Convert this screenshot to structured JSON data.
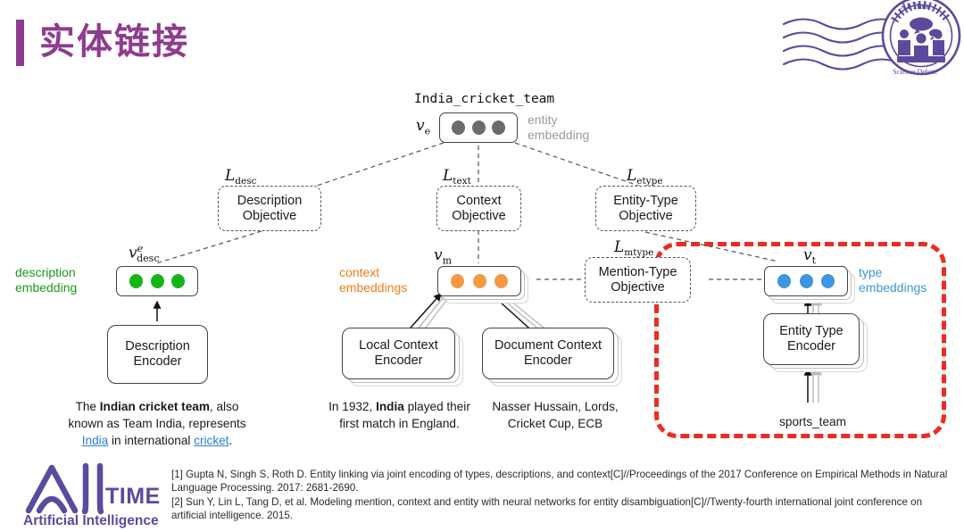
{
  "slide": {
    "title": "实体链接",
    "accent_color": "#8e3c8e"
  },
  "logos": {
    "topright": {
      "name": "ai-time-seal-logo",
      "ring_top_text": "AI Time",
      "ring_bottom_text": "Science Debate"
    },
    "bottom": {
      "name": "ai-time-logo",
      "wordmark": "TIME",
      "subtitle": "Artificial Intelligence"
    }
  },
  "diagram": {
    "entity_name": "India_cricket_team",
    "entity_embedding": {
      "vec_label_base": "v",
      "vec_label_sub": "e",
      "side_label_line1": "entity",
      "side_label_line2": "embedding",
      "dot_color": "#6b6b6b",
      "label_color": "#9a9a9a",
      "dots": 3
    },
    "objectives": [
      {
        "name": "description-objective",
        "loss": "L",
        "loss_sub": "desc",
        "line1": "Description",
        "line2": "Objective"
      },
      {
        "name": "context-objective",
        "loss": "L",
        "loss_sub": "text",
        "line1": "Context",
        "line2": "Objective"
      },
      {
        "name": "entity-type-objective",
        "loss": "L",
        "loss_sub": "etype",
        "line1": "Entity-Type",
        "line2": "Objective"
      },
      {
        "name": "mention-type-objective",
        "loss": "L",
        "loss_sub": "mtype",
        "line1": "Mention-Type",
        "line2": "Objective"
      }
    ],
    "branches": [
      {
        "name": "description-branch",
        "vec_base": "v",
        "vec_sub": "desc",
        "vec_sup": "e",
        "side_label_line1": "description",
        "side_label_line2": "embedding",
        "side_label_position": "left",
        "dot_color": "#16b516",
        "label_color": "#1a9b1a",
        "dots": 3,
        "stacked": false,
        "encoders": [
          {
            "name": "description-encoder",
            "line1": "Description",
            "line2": "Encoder",
            "stacked": false,
            "caption_html": "The <b>Indian cricket team</b>, also<br>known as Team India, represents<br><span class=\"lnk\">India</span> in international <span class=\"lnk\">cricket</span>."
          }
        ]
      },
      {
        "name": "context-branch",
        "vec_base": "v",
        "vec_sub": "m",
        "vec_sup": "",
        "side_label_line1": "context",
        "side_label_line2": "embeddings",
        "side_label_position": "left",
        "dot_color": "#f59a43",
        "label_color": "#f07c1a",
        "dots": 3,
        "stacked": true,
        "encoders": [
          {
            "name": "local-context-encoder",
            "line1": "Local Context",
            "line2": "Encoder",
            "stacked": true,
            "caption_html": "In 1932, <b>India</b> played their<br>first match in England."
          },
          {
            "name": "document-context-encoder",
            "line1": "Document Context",
            "line2": "Encoder",
            "stacked": true,
            "caption_html": "Nasser Hussain, Lords,<br>Cricket Cup, ECB"
          }
        ]
      },
      {
        "name": "type-branch",
        "vec_base": "v",
        "vec_sub": "t",
        "vec_sup": "",
        "side_label_line1": "type",
        "side_label_line2": "embeddings",
        "side_label_position": "right",
        "dot_color": "#3c96e0",
        "label_color": "#3c96e0",
        "dots": 3,
        "stacked": true,
        "encoders": [
          {
            "name": "entity-type-encoder",
            "line1": "Entity Type",
            "line2": "Encoder",
            "stacked": true,
            "caption_html": "sports_team"
          }
        ]
      }
    ],
    "highlight": {
      "name": "type-branch-highlight",
      "color": "#ee2b22",
      "style": "dashed"
    }
  },
  "references": [
    "[1] Gupta N, Singh S, Roth D. Entity linking via joint encoding of types, descriptions, and context[C]//Proceedings of the 2017 Conference on Empirical Methods in Natural Language Processing. 2017: 2681-2690.",
    "[2] Sun Y, Lin L, Tang D, et al. Modeling mention, context and entity with neural networks for entity disambiguation[C]//Twenty-fourth international joint conference on artificial intelligence. 2015."
  ]
}
